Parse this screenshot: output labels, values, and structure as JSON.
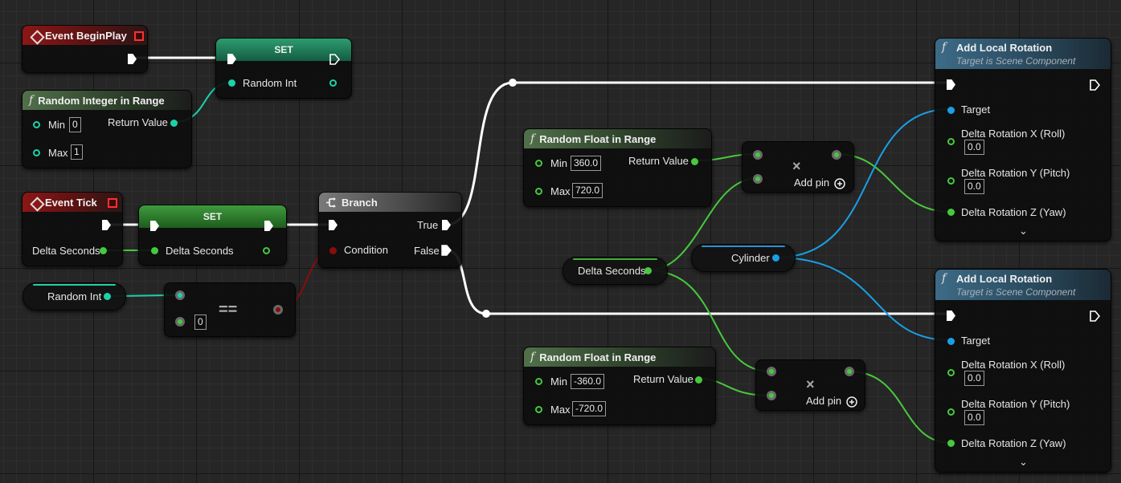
{
  "nodes": {
    "begin_play": {
      "title": "Event BeginPlay"
    },
    "set1": {
      "title": "SET",
      "pin": "Random Int"
    },
    "rand_int": {
      "title": "Random Integer in Range",
      "min_label": "Min",
      "min_value": "0",
      "max_label": "Max",
      "max_value": "1",
      "return_label": "Return Value"
    },
    "event_tick": {
      "title": "Event Tick",
      "pin": "Delta Seconds"
    },
    "set2": {
      "title": "SET",
      "pin": "Delta Seconds"
    },
    "random_int_var": {
      "label": "Random Int"
    },
    "equals": {
      "symbol": "==",
      "value": "0"
    },
    "branch": {
      "title": "Branch",
      "true_label": "True",
      "false_label": "False",
      "condition_label": "Condition"
    },
    "rfloat1": {
      "title": "Random Float in Range",
      "min_label": "Min",
      "min_value": "360.0",
      "max_label": "Max",
      "max_value": "720.0",
      "return_label": "Return Value"
    },
    "rfloat2": {
      "title": "Random Float in Range",
      "min_label": "Min",
      "min_value": "-360.0",
      "max_label": "Max",
      "max_value": "-720.0",
      "return_label": "Return Value"
    },
    "mult1": {
      "symbol": "×",
      "add_pin": "Add pin"
    },
    "mult2": {
      "symbol": "×",
      "add_pin": "Add pin"
    },
    "delta_var": {
      "label": "Delta Seconds"
    },
    "cylinder_var": {
      "label": "Cylinder"
    },
    "rot1": {
      "title": "Add Local Rotation",
      "subtitle": "Target is Scene Component",
      "target": "Target",
      "roll": "Delta Rotation X (Roll)",
      "roll_value": "0.0",
      "pitch": "Delta Rotation Y (Pitch)",
      "pitch_value": "0.0",
      "yaw": "Delta Rotation Z (Yaw)"
    },
    "rot2": {
      "title": "Add Local Rotation",
      "subtitle": "Target is Scene Component",
      "target": "Target",
      "roll": "Delta Rotation X (Roll)",
      "roll_value": "0.0",
      "pitch": "Delta Rotation Y (Pitch)",
      "pitch_value": "0.0",
      "yaw": "Delta Rotation Z (Yaw)"
    }
  },
  "colors": {
    "float_pin": "#47c93d",
    "int_pin": "#1cd2aa",
    "object_pin": "#1a9fe6",
    "bool_pin": "#8b0c0c",
    "exec_wire": "#ffffff"
  },
  "icons": {
    "function": "function-f-icon",
    "event": "event-diamond-icon",
    "branch": "branch-icon",
    "expand": "chevron-down-icon",
    "add": "add-pin-icon"
  }
}
